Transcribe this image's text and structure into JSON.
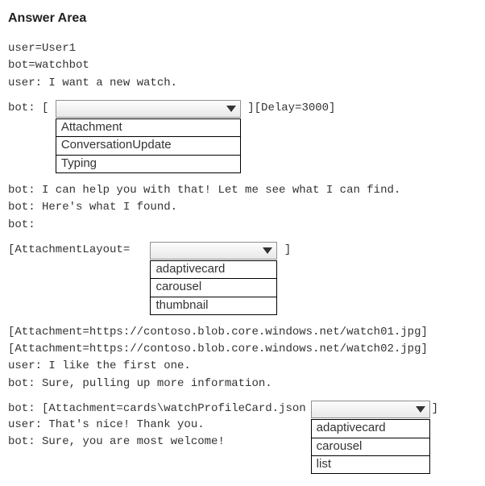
{
  "heading": "Answer Area",
  "pre1_l1": "user=User1",
  "pre1_l2": "bot=watchbot",
  "pre1_l3": "user: I want a new watch.",
  "l_bot_open": "bot: [",
  "l_delay": "][Delay=3000]",
  "dd1": {
    "o1": "Attachment",
    "o2": "ConversationUpdate",
    "o3": "Typing"
  },
  "mid_l1": "bot: I can help you with that! Let me see what I can find.",
  "mid_l2": "bot: Here's what I found.",
  "mid_l3": "bot:",
  "l_attlayout_open": "[AttachmentLayout=",
  "close_bracket": "]",
  "dd2": {
    "o1": "adaptivecard",
    "o2": "carousel",
    "o3": "thumbnail"
  },
  "att_l1": "[Attachment=https://contoso.blob.core.windows.net/watch01.jpg]",
  "att_l2": "[Attachment=https://contoso.blob.core.windows.net/watch02.jpg]",
  "att_l3": "user: I like the first one.",
  "att_l4": "bot: Sure, pulling up more information.",
  "l_card_open": "bot: [Attachment=cards\\watchProfileCard.json",
  "tail_l1": "user: That's nice! Thank you.",
  "tail_l2": "bot: Sure, you are most welcome!",
  "dd3": {
    "o1": "adaptivecard",
    "o2": "carousel",
    "o3": "list"
  }
}
